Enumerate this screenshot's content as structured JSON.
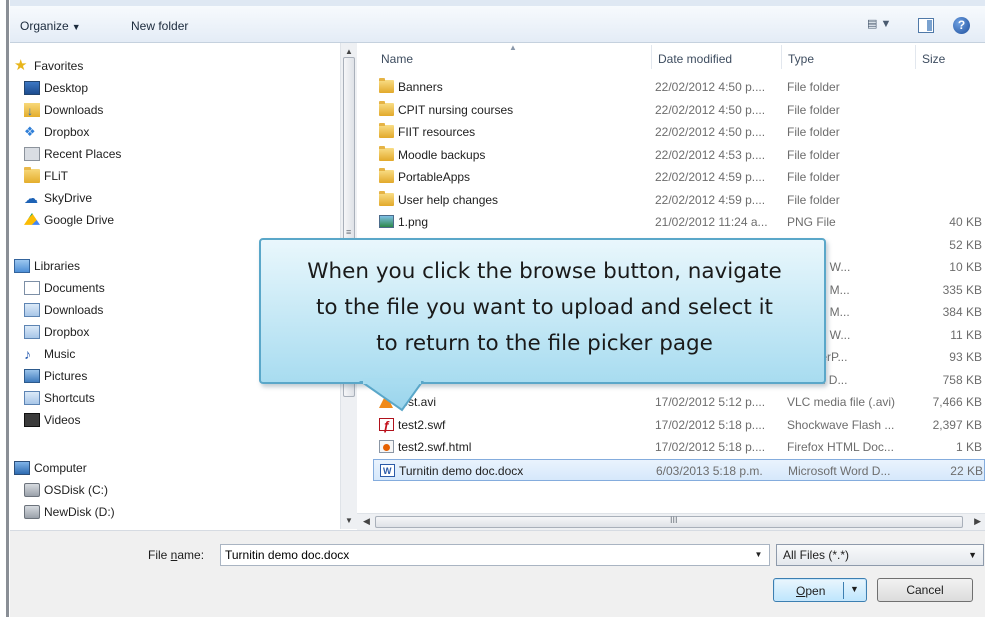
{
  "toolbar": {
    "organize_label": "Organize",
    "new_folder_label": "New folder",
    "views_icon": "views-icon",
    "preview_icon": "preview-pane-icon",
    "help_icon": "help-icon",
    "help_glyph": "?"
  },
  "nav": {
    "favorites": {
      "label": "Favorites",
      "items": [
        "Desktop",
        "Downloads",
        "Dropbox",
        "Recent Places",
        "FLiT",
        "SkyDrive",
        "Google Drive"
      ]
    },
    "libraries": {
      "label": "Libraries",
      "items": [
        "Documents",
        "Downloads",
        "Dropbox",
        "Music",
        "Pictures",
        "Shortcuts",
        "Videos"
      ]
    },
    "computer": {
      "label": "Computer",
      "items": [
        "OSDisk (C:)",
        "NewDisk (D:)"
      ]
    }
  },
  "columns": {
    "name": "Name",
    "date": "Date modified",
    "type": "Type",
    "size": "Size"
  },
  "files": [
    {
      "name": "Banners",
      "date": "22/02/2012 4:50 p....",
      "type": "File folder",
      "size": "",
      "icon": "folder"
    },
    {
      "name": "CPIT nursing courses",
      "date": "22/02/2012 4:50 p....",
      "type": "File folder",
      "size": "",
      "icon": "folder"
    },
    {
      "name": "FIIT resources",
      "date": "22/02/2012 4:50 p....",
      "type": "File folder",
      "size": "",
      "icon": "folder"
    },
    {
      "name": "Moodle backups",
      "date": "22/02/2012 4:53 p....",
      "type": "File folder",
      "size": "",
      "icon": "folder"
    },
    {
      "name": "PortableApps",
      "date": "22/02/2012 4:59 p....",
      "type": "File folder",
      "size": "",
      "icon": "folder"
    },
    {
      "name": "User help changes",
      "date": "22/02/2012 4:59 p....",
      "type": "File folder",
      "size": "",
      "icon": "folder"
    },
    {
      "name": "1.png",
      "date": "21/02/2012 11:24 a...",
      "type": "PNG File",
      "size": "40 KB",
      "icon": "png"
    },
    {
      "name": "",
      "date": "",
      "type": "",
      "size": "52 KB",
      "icon": ""
    },
    {
      "name": "",
      "date": "",
      "type": "ft Excel W...",
      "size": "10 KB",
      "icon": ""
    },
    {
      "name": "",
      "date": "",
      "type": "ft Excel M...",
      "size": "335 KB",
      "icon": ""
    },
    {
      "name": "",
      "date": "",
      "type": "ft Excel M...",
      "size": "384 KB",
      "icon": ""
    },
    {
      "name": "",
      "date": "",
      "type": "ft Excel W...",
      "size": "11 KB",
      "icon": ""
    },
    {
      "name": "",
      "date": "",
      "type": "ft PowerP...",
      "size": "93 KB",
      "icon": ""
    },
    {
      "name": "",
      "date": "",
      "type": "ft Word D...",
      "size": "758 KB",
      "icon": ""
    },
    {
      "name": "test.avi",
      "date": "17/02/2012 5:12 p....",
      "type": "VLC media file (.avi)",
      "size": "7,466 KB",
      "icon": "avi"
    },
    {
      "name": "test2.swf",
      "date": "17/02/2012 5:18 p....",
      "type": "Shockwave Flash ...",
      "size": "2,397 KB",
      "icon": "swf"
    },
    {
      "name": "test2.swf.html",
      "date": "17/02/2012 5:18 p....",
      "type": "Firefox HTML Doc...",
      "size": "1 KB",
      "icon": "html"
    },
    {
      "name": "Turnitin demo doc.docx",
      "date": "6/03/2013 5:18 p.m.",
      "type": "Microsoft Word D...",
      "size": "22 KB",
      "icon": "doc",
      "selected": true
    }
  ],
  "bottom": {
    "file_name_label_pre": "File ",
    "file_name_label_ul": "n",
    "file_name_label_post": "ame:",
    "file_name_value": "Turnitin demo doc.docx",
    "filter_value": "All Files (*.*)",
    "open_ul": "O",
    "open_rest": "pen",
    "cancel_label": "Cancel"
  },
  "callout": {
    "lines": [
      "When you click the browse button, navigate",
      "to the file you want to upload and select it",
      "to return to the file picker page"
    ]
  },
  "scroll": {
    "hscroll_grip": "III"
  }
}
